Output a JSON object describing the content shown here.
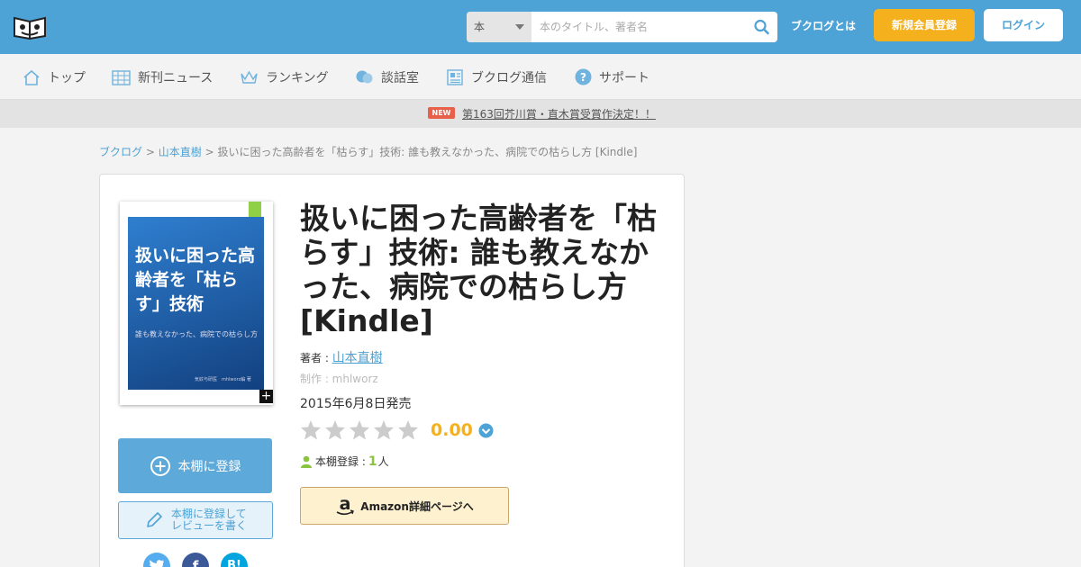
{
  "header": {
    "search_category": "本",
    "search_placeholder": "本のタイトル、著者名",
    "about_label": "ブクログとは",
    "signup_label": "新規会員登録",
    "login_label": "ログイン"
  },
  "nav": {
    "items": [
      {
        "label": "トップ",
        "icon": "home-icon"
      },
      {
        "label": "新刊ニュース",
        "icon": "calendar-icon"
      },
      {
        "label": "ランキング",
        "icon": "crown-icon"
      },
      {
        "label": "談話室",
        "icon": "chat-icon"
      },
      {
        "label": "ブクログ通信",
        "icon": "newspaper-icon"
      },
      {
        "label": "サポート",
        "icon": "help-icon"
      }
    ]
  },
  "news": {
    "badge": "NEW",
    "text": "第163回芥川賞・直木賞受賞作決定！！"
  },
  "breadcrumb": {
    "root": "ブクログ",
    "sep": ">",
    "author": "山本直樹",
    "current": "扱いに困った高齢者を「枯らす」技術: 誰も教えなかった、病院での枯らし方 [Kindle]"
  },
  "book": {
    "title": "扱いに困った高齢者を「枯らす」技術: 誰も教えなかった、病院での枯らし方 [Kindle]",
    "author_prefix": "著者 : ",
    "author": "山本直樹",
    "maker": "制作 : mhlworz",
    "release": "2015年6月8日発売",
    "rating": "0.00",
    "rating_stars": 0,
    "shelf_prefix": "本棚登録 : ",
    "shelf_count": "1",
    "shelf_suffix": "人",
    "amazon_label": "Amazon詳細ページへ",
    "cover": {
      "title": "扱いに困った高齢者を「枯らす」技術",
      "subtitle": "誰も教えなかった、病院での枯らし方",
      "publisher": "気紋与研医　mhlworz編 著"
    }
  },
  "actions": {
    "shelf_label": "本棚に登録",
    "review_label_1": "本棚に登録して",
    "review_label_2": "レビューを書く",
    "social": [
      {
        "name": "twitter-icon",
        "glyph": "",
        "color": "#55acee"
      },
      {
        "name": "facebook-icon",
        "glyph": "f",
        "color": "#3b5998"
      },
      {
        "name": "hatena-bookmark-icon",
        "glyph": "B!",
        "color": "#00a4de"
      }
    ]
  },
  "colors": {
    "header": "#4da2d6",
    "accent_orange": "#f5b01d",
    "star_empty": "#cccccc",
    "shelf_green": "#8ac43f"
  }
}
